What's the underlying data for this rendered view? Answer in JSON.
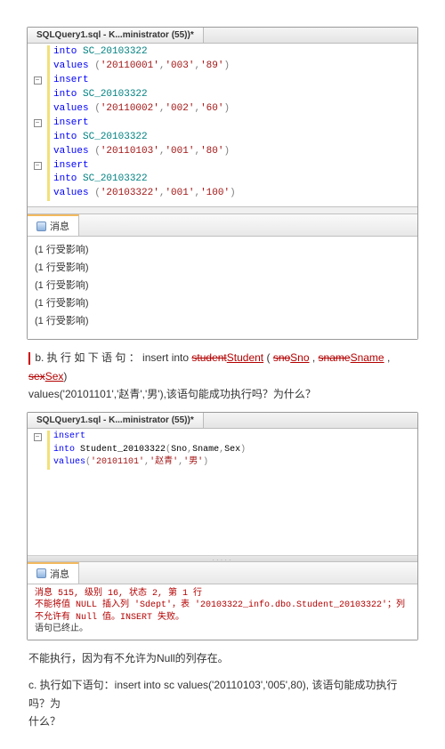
{
  "window1": {
    "tab_title": "SQLQuery1.sql - K...ministrator (55))*",
    "code_lines": [
      {
        "gutter": "",
        "html": "<span class='kw-blue'>into</span> <span class='kw-teal'>SC_20103322</span>"
      },
      {
        "gutter": "",
        "html": "<span class='kw-blue'>values</span> <span class='op-gray'>(</span><span class='str-red'>'20110001'</span><span class='op-gray'>,</span><span class='str-red'>'003'</span><span class='op-gray'>,</span><span class='str-red'>'89'</span><span class='op-gray'>)</span>"
      },
      {
        "gutter": "-",
        "html": "<span class='kw-blue'>insert</span>"
      },
      {
        "gutter": "",
        "html": "<span class='kw-blue'>into</span> <span class='kw-teal'>SC_20103322</span>"
      },
      {
        "gutter": "",
        "html": "<span class='kw-blue'>values</span> <span class='op-gray'>(</span><span class='str-red'>'20110002'</span><span class='op-gray'>,</span><span class='str-red'>'002'</span><span class='op-gray'>,</span><span class='str-red'>'60'</span><span class='op-gray'>)</span>"
      },
      {
        "gutter": "-",
        "html": "<span class='kw-blue'>insert</span>"
      },
      {
        "gutter": "",
        "html": "<span class='kw-blue'>into</span> <span class='kw-teal'>SC_20103322</span>"
      },
      {
        "gutter": "",
        "html": "<span class='kw-blue'>values</span> <span class='op-gray'>(</span><span class='str-red'>'20110103'</span><span class='op-gray'>,</span><span class='str-red'>'001'</span><span class='op-gray'>,</span><span class='str-red'>'80'</span><span class='op-gray'>)</span>"
      },
      {
        "gutter": "-",
        "html": "<span class='kw-blue'>insert</span>"
      },
      {
        "gutter": "",
        "html": "<span class='kw-blue'>into</span> <span class='kw-teal'>SC_20103322</span>"
      },
      {
        "gutter": "",
        "html": "<span class='kw-blue'>values</span> <span class='op-gray'>(</span><span class='str-red'>'20103322'</span><span class='op-gray'>,</span><span class='str-red'>'001'</span><span class='op-gray'>,</span><span class='str-red'>'100'</span><span class='op-gray'>)</span>"
      }
    ],
    "messages_tab": "消息",
    "messages": [
      "(1 行受影响)",
      "(1 行受影响)",
      "(1 行受影响)",
      "(1 行受影响)",
      "(1 行受影响)"
    ]
  },
  "question_b": {
    "label": "b.  执 行 如 下 语 句 ： insert  into ",
    "strike1": "student",
    "ul1": "Student",
    "paren_open": " ( ",
    "strike2": "sno",
    "ul2": "Sno",
    "comma1": " , ",
    "strike3": "sname",
    "ul3": "Sname",
    "comma2": " , ",
    "strike4": "sex",
    "ul4": "Sex",
    "paren_close": ") ",
    "line2": "values('20101101','赵青','男'),该语句能成功执行吗？为什么？"
  },
  "window2": {
    "tab_title": "SQLQuery1.sql - K...ministrator (55))*",
    "code_lines": [
      {
        "gutter": "-",
        "html": "<span class='kw-blue'>insert</span>"
      },
      {
        "gutter": "",
        "html": "<span class='kw-blue'>into</span> Student_20103322<span class='op-gray'>(</span>Sno<span class='op-gray'>,</span>Sname<span class='op-gray'>,</span>Sex<span class='op-gray'>)</span>"
      },
      {
        "gutter": "",
        "html": "<span class='kw-blue'>values</span><span class='op-gray'>(</span><span class='str-red'>'20101101'</span><span class='op-gray'>,</span><span class='str-red'>'赵青'</span><span class='op-gray'>,</span><span class='str-red'>'男'</span><span class='op-gray'>)</span>"
      }
    ],
    "messages_tab": "消息",
    "error_line1": "消息 515, 级别 16, 状态 2, 第 1 行",
    "error_line2": "不能将值 NULL 插入列 'Sdept'，表 '20103322_info.dbo.Student_20103322'；列不允许有 Null 值。INSERT 失败。",
    "error_line3": "语句已终止。"
  },
  "answer_b": "不能执行，因为有不允许为Null的列存在。",
  "question_c": {
    "text1": "c.  执行如下语句：insert into sc values('20110103','005',80), 该语句能成功执行吗？为",
    "text2": "什么？"
  }
}
